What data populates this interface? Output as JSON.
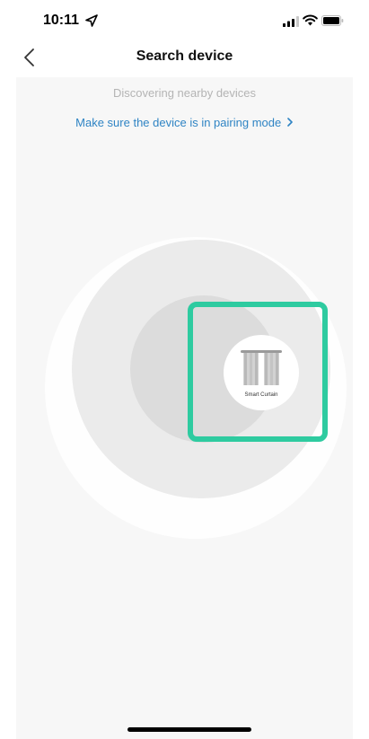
{
  "status_bar": {
    "time": "10:11",
    "icons": [
      "location-arrow-icon",
      "cellular-signal-icon",
      "wifi-icon",
      "battery-icon"
    ]
  },
  "nav": {
    "title": "Search device",
    "back_icon": "chevron-left-icon"
  },
  "content": {
    "discover_text": "Discovering nearby devices",
    "pairing_link": "Make sure the device is in pairing mode",
    "pairing_link_icon": "chevron-right-icon"
  },
  "device": {
    "label": "Smart Curtain",
    "icon": "curtain-icon"
  },
  "colors": {
    "accent": "#2ecba0",
    "link": "#2f84c4",
    "muted_text": "#b4b4b4",
    "background": "#f7f7f7"
  }
}
